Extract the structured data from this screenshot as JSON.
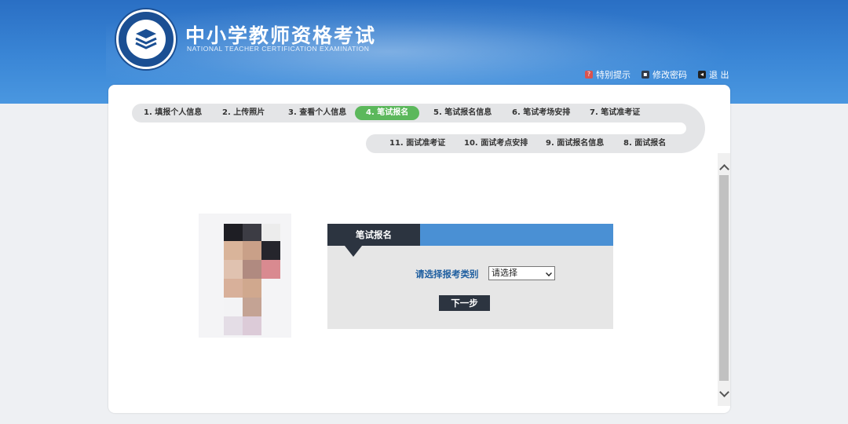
{
  "header": {
    "title": "中小学教师资格考试",
    "subtitle": "NATIONAL TEACHER CERTIFICATION EXAMINATION",
    "links": [
      {
        "icon": "info-icon",
        "label": "特别提示"
      },
      {
        "icon": "key-icon",
        "label": "修改密码"
      },
      {
        "icon": "logout-icon",
        "label": "退 出"
      }
    ]
  },
  "steps": {
    "row1": [
      "1. 填报个人信息",
      "2. 上传照片",
      "3. 查看个人信息",
      "4. 笔试报名",
      "5. 笔试报名信息",
      "6. 笔试考场安排",
      "7. 笔试准考证"
    ],
    "row2": [
      "11. 面试准考证",
      "10. 面试考点安排",
      "9. 面试报名信息",
      "8. 面试报名"
    ],
    "active": "4. 笔试报名"
  },
  "form": {
    "tab_label": "笔试报名",
    "field_label": "请选择报考类别",
    "select_value": "请选择",
    "next_label": "下一步"
  },
  "colors": {
    "header_blue": "#3a86d6",
    "active_step": "#5cb85c",
    "form_tab": "#2c3440",
    "form_head": "#4a90d4",
    "label_blue": "#1f5fa0"
  }
}
